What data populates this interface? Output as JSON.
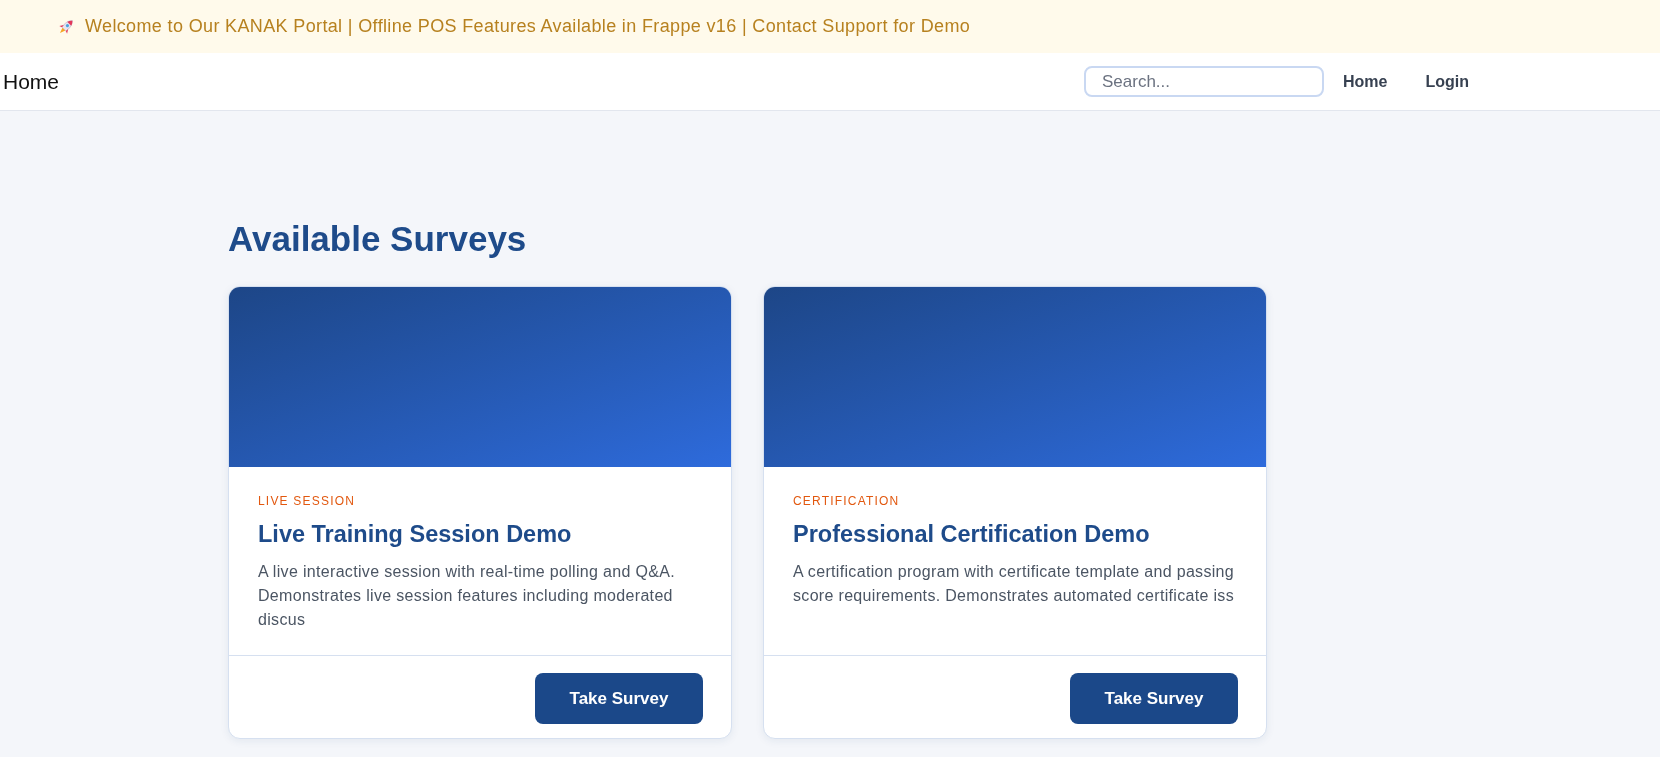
{
  "announcement": {
    "text": "Welcome to Our KANAK Portal | Offline POS Features Available in Frappe v16 | Contact Support for Demo"
  },
  "navbar": {
    "brand": "Home",
    "search": {
      "placeholder": "Search..."
    },
    "links": [
      "Home",
      "Login"
    ]
  },
  "page": {
    "title": "Available Surveys"
  },
  "surveys": [
    {
      "category": "LIVE SESSION",
      "title": "Live Training Session Demo",
      "description": "A live interactive session with real-time polling and Q&A. Demonstrates live session features including moderated discus",
      "action": "Take Survey"
    },
    {
      "category": "CERTIFICATION",
      "title": "Professional Certification Demo",
      "description": "A certification program with certificate template and passing score requirements. Demonstrates automated certificate iss",
      "action": "Take Survey"
    }
  ]
}
